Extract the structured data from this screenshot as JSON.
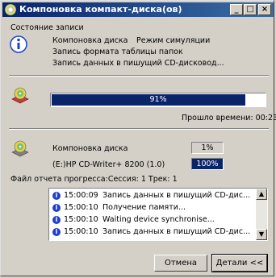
{
  "window": {
    "title": "Компоновка компакт-диска(ов)",
    "buttons": {
      "minimize": "_",
      "maximize": "□",
      "close": "×"
    }
  },
  "status_group": {
    "heading": "Состояние записи",
    "mode_label": "Компоновка диска",
    "mode_value": "Режим симуляции",
    "line2": "Запись формата таблицы папок",
    "line3": "Запись данных в пишущий CD-дисковод..."
  },
  "progress_main": {
    "percent_text": "91%",
    "fraction": 0.91,
    "elapsed_label": "Прошло времени: 00:23"
  },
  "disc": {
    "layout_label": "Компоновка диска",
    "layout_value": "1%",
    "drive_label": "(E:)HP CD-Writer+ 8200 (1.0)",
    "drive_value": "100%"
  },
  "log": {
    "heading": "Файл отчета прогресса:Сессия: 1 Трек: 1",
    "rows": [
      {
        "time": "15:00:09",
        "text": "Запись данных в пишущий CD-дис..."
      },
      {
        "time": "15:00:10",
        "text": "Получение памяти..."
      },
      {
        "time": "15:00:10",
        "text": "Waiting device synchronise..."
      },
      {
        "time": "15:00:10",
        "text": "Запись данных в пишущий CD-дис..."
      }
    ]
  },
  "footer": {
    "cancel_label": "Отмена",
    "details_label": "Детали <<"
  },
  "colors": {
    "title_bar": "#0a246a",
    "progress_fill": "#0a246a",
    "info_icon": "#1f3fd0"
  }
}
